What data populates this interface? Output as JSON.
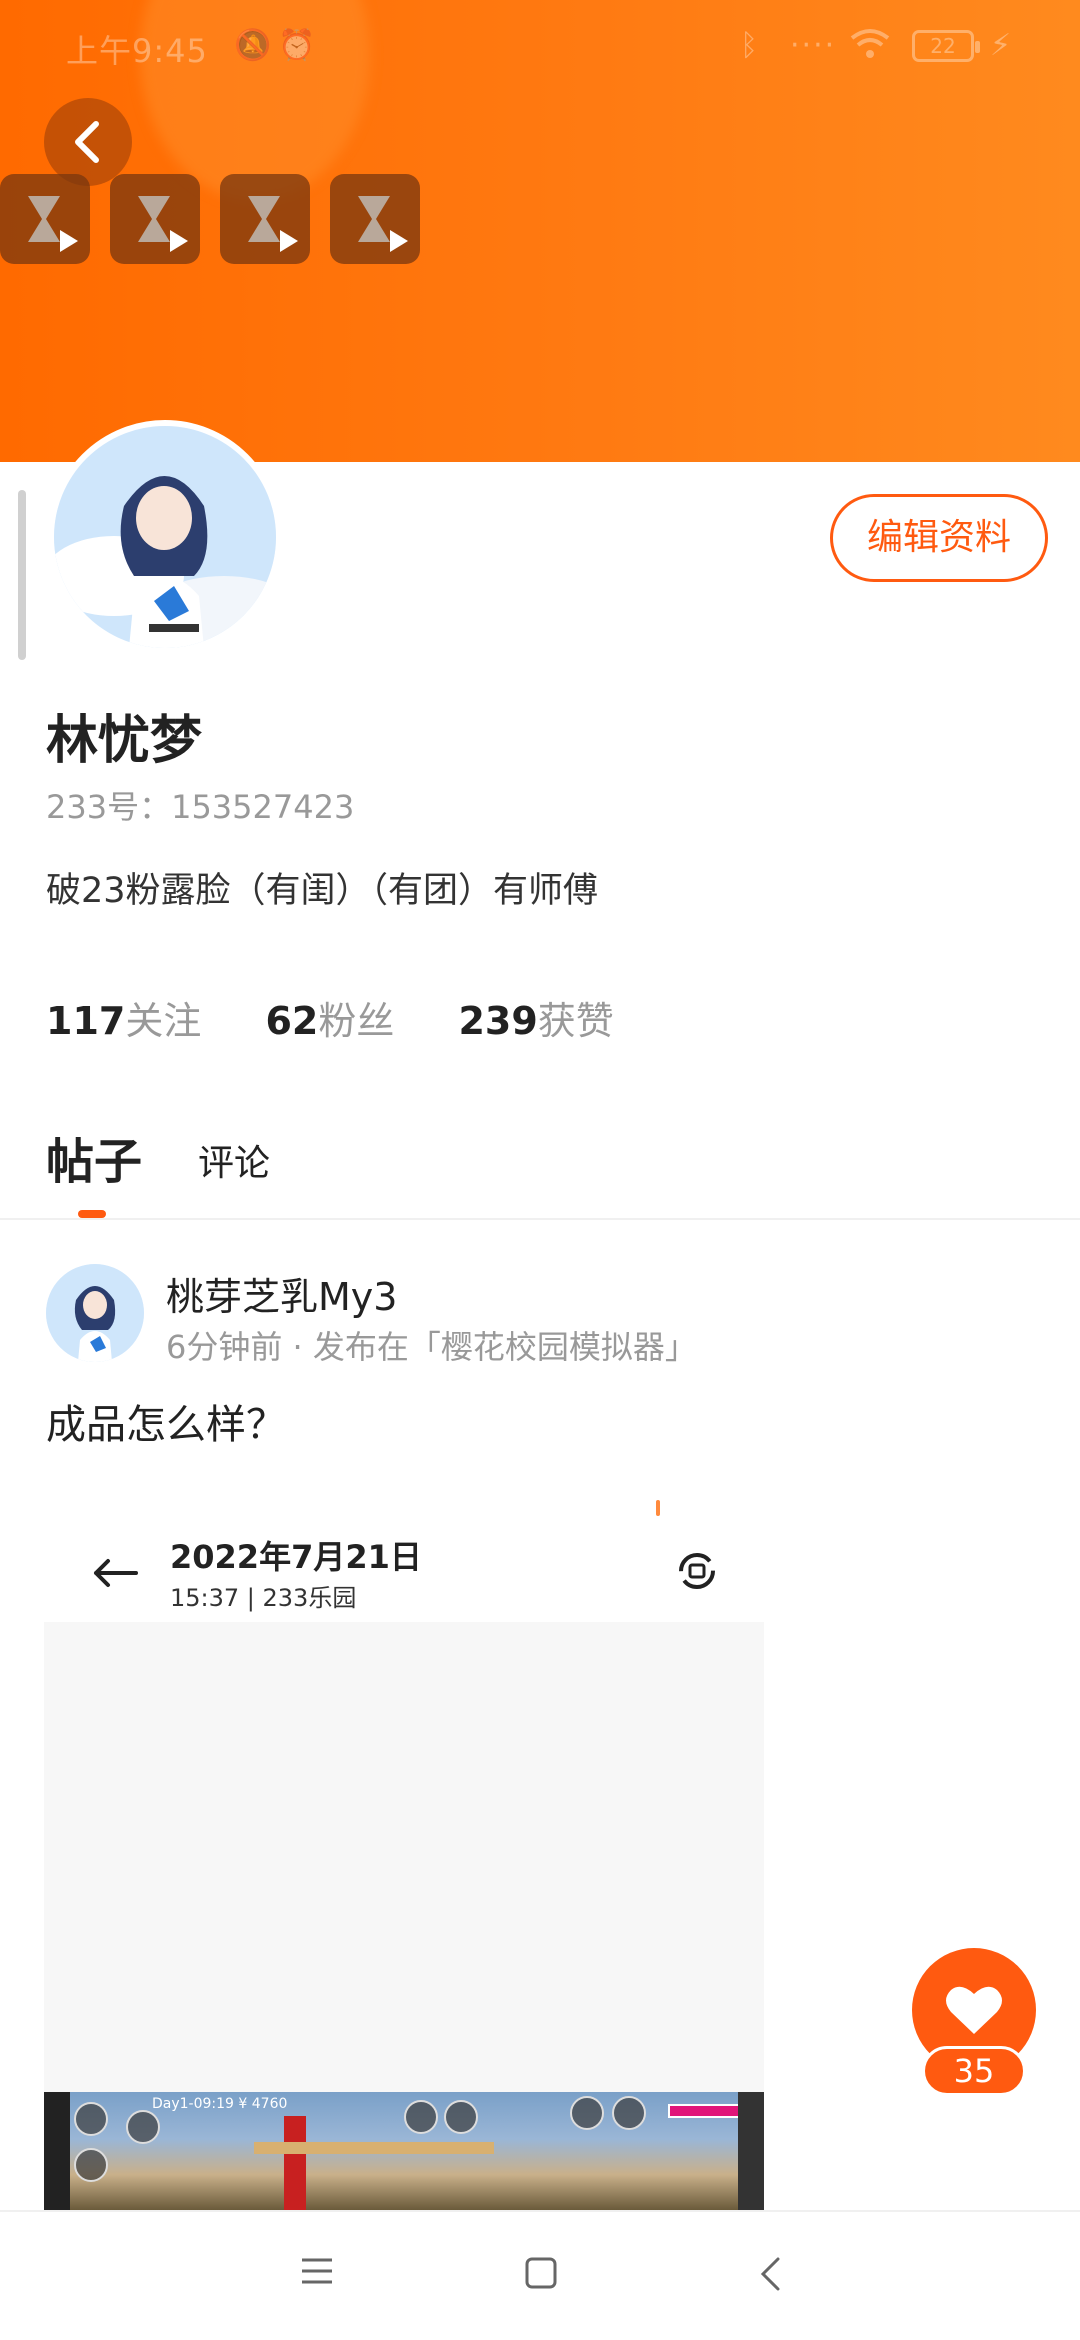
{
  "status_bar": {
    "time": "上午9:45",
    "battery": "22"
  },
  "profile": {
    "name": "林忧梦",
    "id_label": "233号：153527423",
    "bio": "破23粉露脸（有闺）（有团）有师傅",
    "edit_button": "编辑资料",
    "stats": [
      {
        "num": "117",
        "label": "关注"
      },
      {
        "num": "62",
        "label": "粉丝"
      },
      {
        "num": "239",
        "label": "获赞"
      }
    ]
  },
  "tabs": {
    "active": "帖子",
    "other": "评论"
  },
  "post": {
    "author": "桃芽芝乳My3",
    "meta": "6分钟前 · 发布在「樱花校园模拟器」",
    "text": "成品怎么样？",
    "screenshot": {
      "date": "2022年7月21日",
      "sub": "15:37 | 233乐园",
      "hud": "Day1-09:19  ¥ 4760"
    }
  },
  "like": {
    "count": "35"
  },
  "icons": [
    "back-icon",
    "hourglass-play-icon",
    "heart-icon",
    "menu-icon",
    "home-icon",
    "nav-back-icon",
    "rotate-icon",
    "arrow-left-icon"
  ],
  "colors": {
    "accent": "#ff5a10",
    "header": "#ff7a12"
  }
}
